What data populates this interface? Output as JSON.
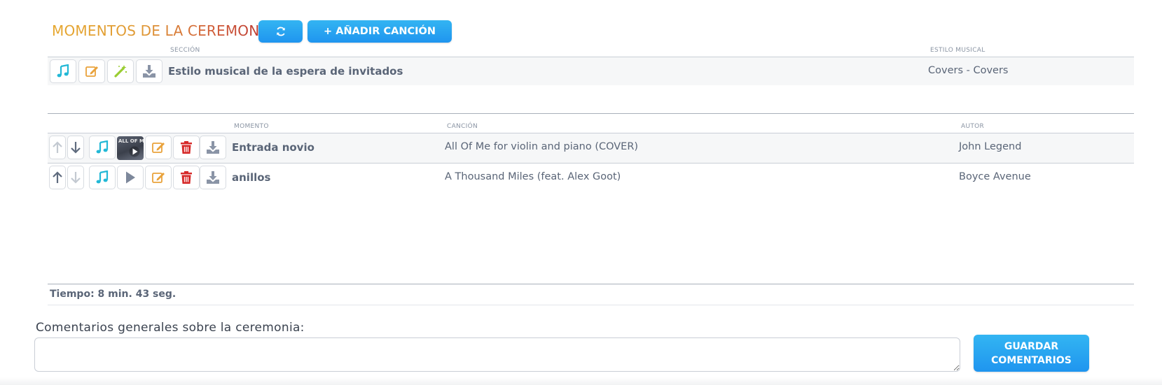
{
  "header": {
    "title": "MOMENTOS DE LA CEREMONIA",
    "add_song_label": "+ AÑADIR CANCIÓN"
  },
  "section_table": {
    "col_section": "SECCIÓN",
    "col_style": "ESTILO MUSICAL",
    "rows": [
      {
        "name": "Estilo musical de la espera de invitados",
        "style": "Covers - Covers"
      }
    ]
  },
  "moments_table": {
    "col_moment": "MOMENTO",
    "col_song": "CANCIÓN",
    "col_author": "AUTOR",
    "rows": [
      {
        "moment": "Entrada novio",
        "song": "All Of Me for violin and piano (COVER)",
        "author": "John Legend",
        "thumb_text": "ALL OF ME"
      },
      {
        "moment": "anillos",
        "song": "A Thousand Miles (feat. Alex Goot)",
        "author": "Boyce Avenue"
      }
    ]
  },
  "summary": {
    "time_text": "Tiempo: 8 min. 43 seg."
  },
  "comments": {
    "label": "Comentarios generales sobre la ceremonia:",
    "value": "",
    "save_label_line1": "GUARDAR",
    "save_label_line2": "COMENTARIOS"
  },
  "colors": {
    "accent_blue": "#1f95ef",
    "music_icon": "#22b8d6",
    "edit_icon": "#e9a23b",
    "magic_icon": "#9acd32",
    "delete_icon": "#d62828",
    "title_gradient_start": "#e6a72e",
    "title_gradient_end": "#b8322f"
  },
  "icons": [
    "refresh-icon",
    "music-note-icon",
    "edit-icon",
    "magic-wand-icon",
    "download-icon",
    "arrow-up-icon",
    "arrow-down-icon",
    "trash-icon",
    "play-icon"
  ]
}
